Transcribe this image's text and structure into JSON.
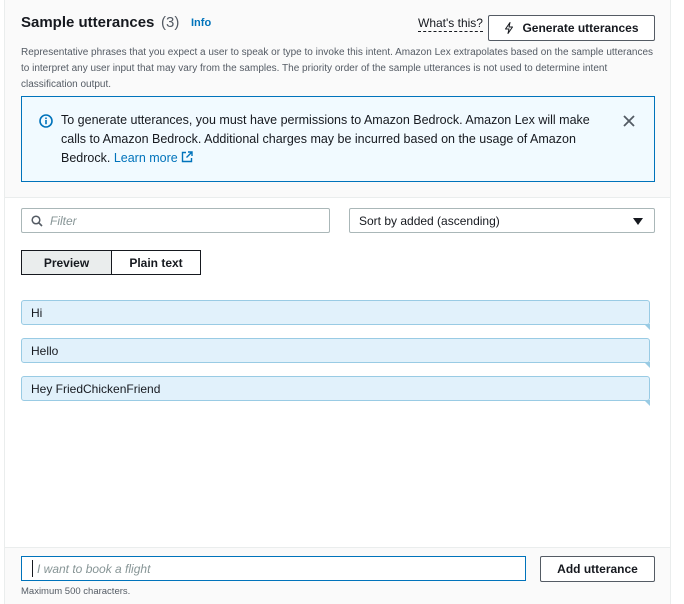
{
  "header": {
    "title": "Sample utterances",
    "count": "(3)",
    "info_link": "Info",
    "whats_this": "What's this?",
    "generate_button": "Generate utterances",
    "description": "Representative phrases that you expect a user to speak or type to invoke this intent. Amazon Lex extrapolates based on the sample utterances to interpret any user input that may vary from the samples. The priority order of the sample utterances is not used to determine intent classification output."
  },
  "alert": {
    "text": "To generate utterances, you must have permissions to Amazon Bedrock. Amazon Lex will make calls to Amazon Bedrock. Additional charges may be incurred based on the usage of Amazon Bedrock.",
    "link_text": "Learn more",
    "icon": "info-circle-icon",
    "color": "#0073bb"
  },
  "filter": {
    "placeholder": "Filter"
  },
  "sort": {
    "selected": "Sort by added (ascending)"
  },
  "view_toggle": {
    "preview": "Preview",
    "plain_text": "Plain text",
    "selected": "Preview"
  },
  "utterances": [
    {
      "text": "Hi"
    },
    {
      "text": "Hello"
    },
    {
      "text": "Hey FriedChickenFriend"
    }
  ],
  "add": {
    "placeholder": "I want to book a flight",
    "button": "Add utterance",
    "hint": "Maximum 500 characters."
  },
  "colors": {
    "accent": "#0073bb",
    "utterance_bg": "#e1f1fb",
    "alert_bg": "#f1faff"
  }
}
